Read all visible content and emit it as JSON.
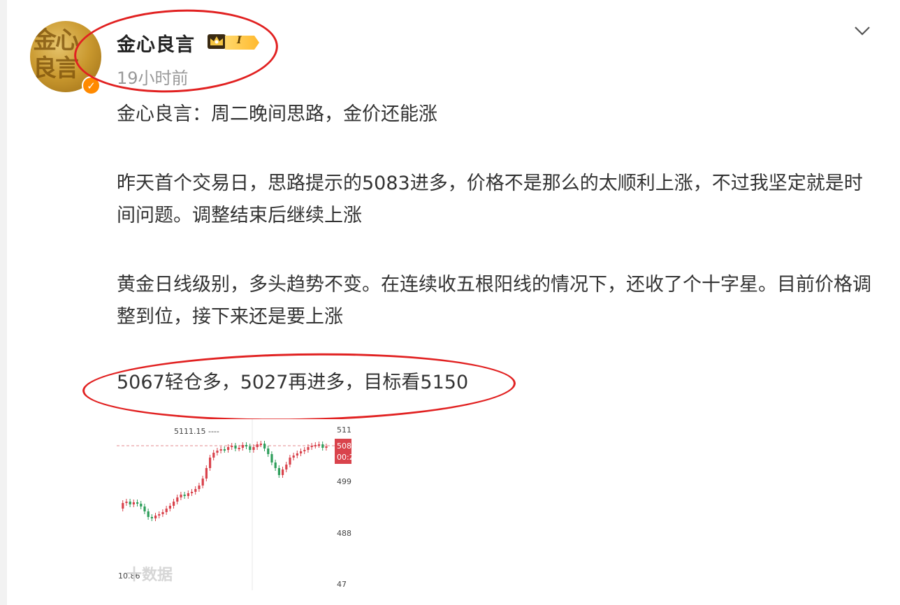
{
  "post": {
    "author": "金心良言",
    "level": "I",
    "time": "19小时前",
    "avatar_glyphs": "金心\n良言",
    "paragraphs": [
      "金心良言：周二晚间思路，金价还能涨",
      "昨天首个交易日，思路提示的5083进多，价格不是那么的太顺利上涨，不过我坚定就是时间问题。调整结束后继续上涨",
      "黄金日线级别，多头趋势不变。在连续收五根阳线的情况下，还收了个十字星。目前价格调整到位，接下来还是要上涨",
      "5067轻仓多，5027再进多，目标看5150"
    ]
  },
  "chart_data": {
    "type": "candlestick",
    "max_label": "5111.15 ----",
    "price_labels": [
      "511",
      "508",
      "00:2",
      "499",
      "488",
      "47"
    ],
    "bottom_left_label": "10.86",
    "watermark": "十数据"
  },
  "icons": {
    "crown": "crown-icon",
    "verified": "verified-badge-icon",
    "more": "chevron-down-icon"
  },
  "colors": {
    "annotation": "#e12121",
    "verified": "#ff8a00",
    "up": "#d9434c",
    "down": "#2e9e5b"
  }
}
